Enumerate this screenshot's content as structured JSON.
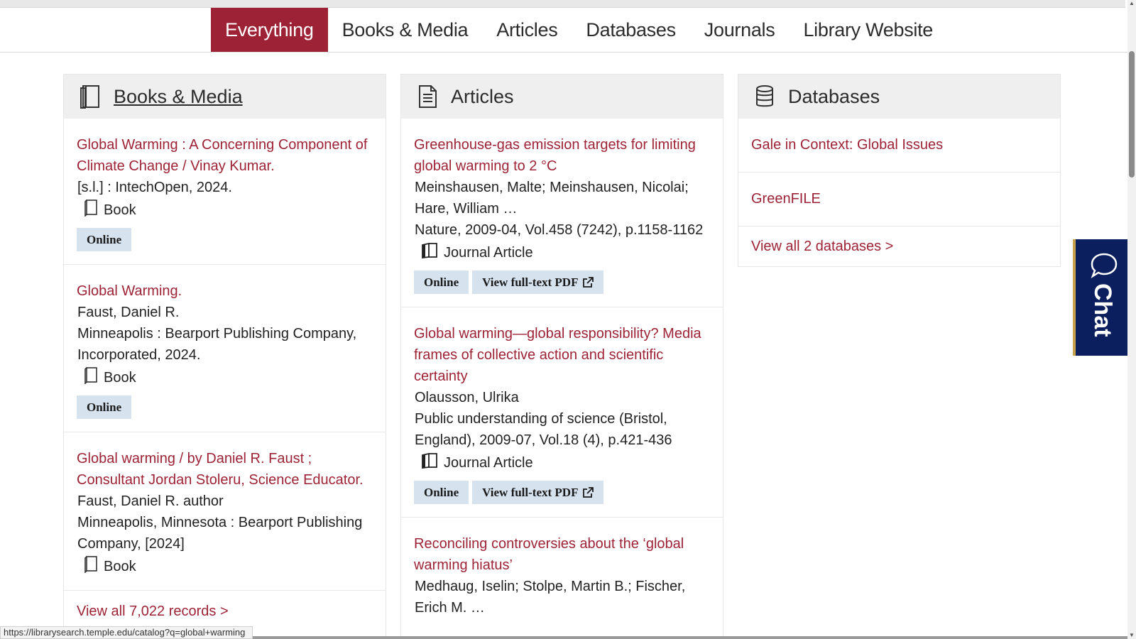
{
  "tabs": [
    {
      "label": "Everything",
      "active": true
    },
    {
      "label": "Books & Media"
    },
    {
      "label": "Articles"
    },
    {
      "label": "Databases"
    },
    {
      "label": "Journals"
    },
    {
      "label": "Library Website"
    }
  ],
  "books": {
    "title": "Books & Media",
    "icon": "book-icon",
    "records": [
      {
        "title": "Global Warming : A Concerning Component of Climate Change / Vinay Kumar.",
        "lines": [
          "[s.l.] : IntechOpen, 2024."
        ],
        "type": "Book",
        "badges": [
          "Online"
        ]
      },
      {
        "title": "Global Warming.",
        "lines": [
          "Faust, Daniel R.",
          "Minneapolis : Bearport Publishing Company, Incorporated, 2024."
        ],
        "type": "Book",
        "badges": [
          "Online"
        ]
      },
      {
        "title": "Global warming / by Daniel R. Faust ; Consultant Jordan Stoleru, Science Educator.",
        "lines": [
          "Faust, Daniel R. author",
          "Minneapolis, Minnesota : Bearport Publishing Company, [2024]"
        ],
        "type": "Book",
        "badges": []
      }
    ],
    "view_all": "View all 7,022 records >"
  },
  "articles": {
    "title": "Articles",
    "icon": "document-icon",
    "records": [
      {
        "title": "Greenhouse-gas emission targets for limiting global warming to 2 °C",
        "lines": [
          "Meinshausen, Malte; Meinshausen, Nicolai; Hare, William …",
          "Nature, 2009-04, Vol.458 (7242), p.1158-1162"
        ],
        "type": "Journal Article",
        "badges": [
          "Online",
          "View full-text PDF"
        ]
      },
      {
        "title": "Global warming—global responsibility? Media frames of collective action and scientific certainty",
        "lines": [
          "Olausson, Ulrika",
          "Public understanding of science (Bristol, England), 2009-07, Vol.18 (4), p.421-436"
        ],
        "type": "Journal Article",
        "badges": [
          "Online",
          "View full-text PDF"
        ]
      },
      {
        "title": "Reconciling controversies about the ‘global warming hiatus’",
        "lines": [
          "Medhaug, Iselin; Stolpe, Martin B.; Fischer, Erich M. …"
        ],
        "type": "",
        "badges": []
      }
    ]
  },
  "databases": {
    "title": "Databases",
    "icon": "database-icon",
    "items": [
      "Gale in Context: Global Issues",
      "GreenFILE"
    ],
    "view_all": "View all 2 databases >"
  },
  "chat": {
    "label": "Chat"
  },
  "status_url": "https://librarysearch.temple.edu/catalog?q=global+warming",
  "colors": {
    "brand": "#9d2235",
    "badge_bg": "#d6e2ee",
    "chat_bg": "#0b1f5e"
  }
}
